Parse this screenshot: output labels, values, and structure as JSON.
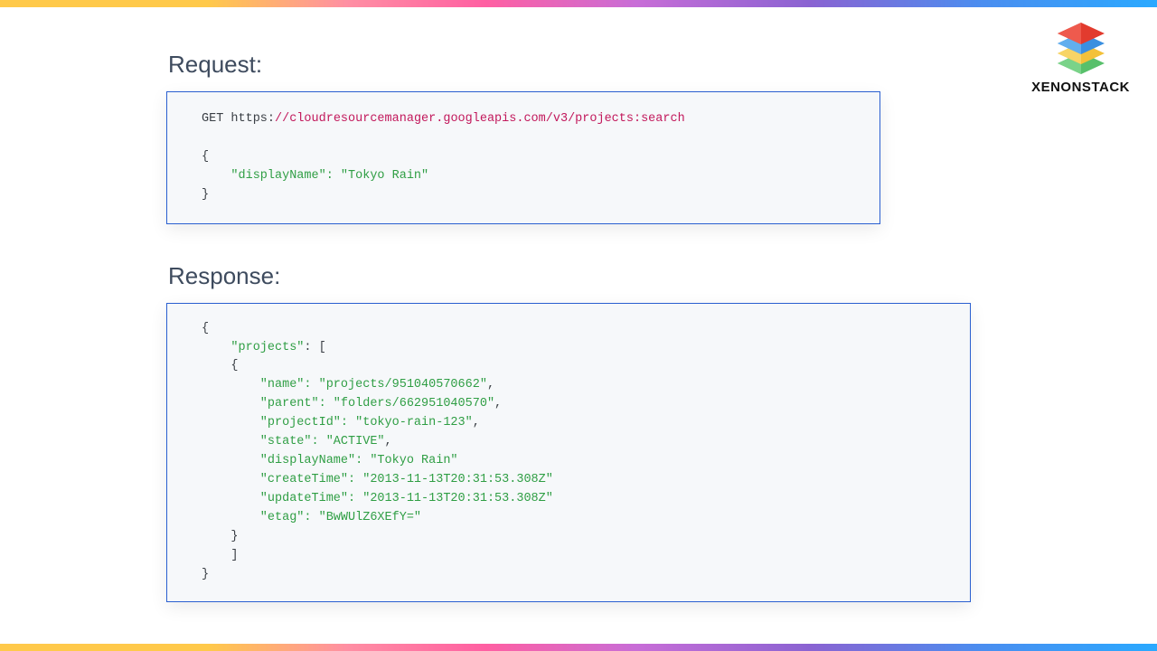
{
  "logo": {
    "text": "XENONSTACK"
  },
  "request": {
    "heading": "Request:",
    "method": "GET ",
    "scheme": "https:",
    "url": "//cloudresourcemanager.googleapis.com/v3/projects:search",
    "bodyLine": "\"displayName\": \"Tokyo Rain\""
  },
  "response": {
    "heading": "Response:",
    "k_projects": "\"projects\"",
    "v_name": "\"name\": \"projects/951040570662\"",
    "v_parent": "\"parent\": \"folders/662951040570\"",
    "v_projectId": "\"projectId\": \"tokyo-rain-123\"",
    "v_state": "\"state\": \"ACTIVE\"",
    "v_displayName": "\"displayName\": \"Tokyo Rain\"",
    "v_createTime": "\"createTime\": \"2013-11-13T20:31:53.308Z\"",
    "v_updateTime": "\"updateTime\": \"2013-11-13T20:31:53.308Z\"",
    "v_etag": "\"etag\": \"BwWUlZ6XEfY=\""
  }
}
